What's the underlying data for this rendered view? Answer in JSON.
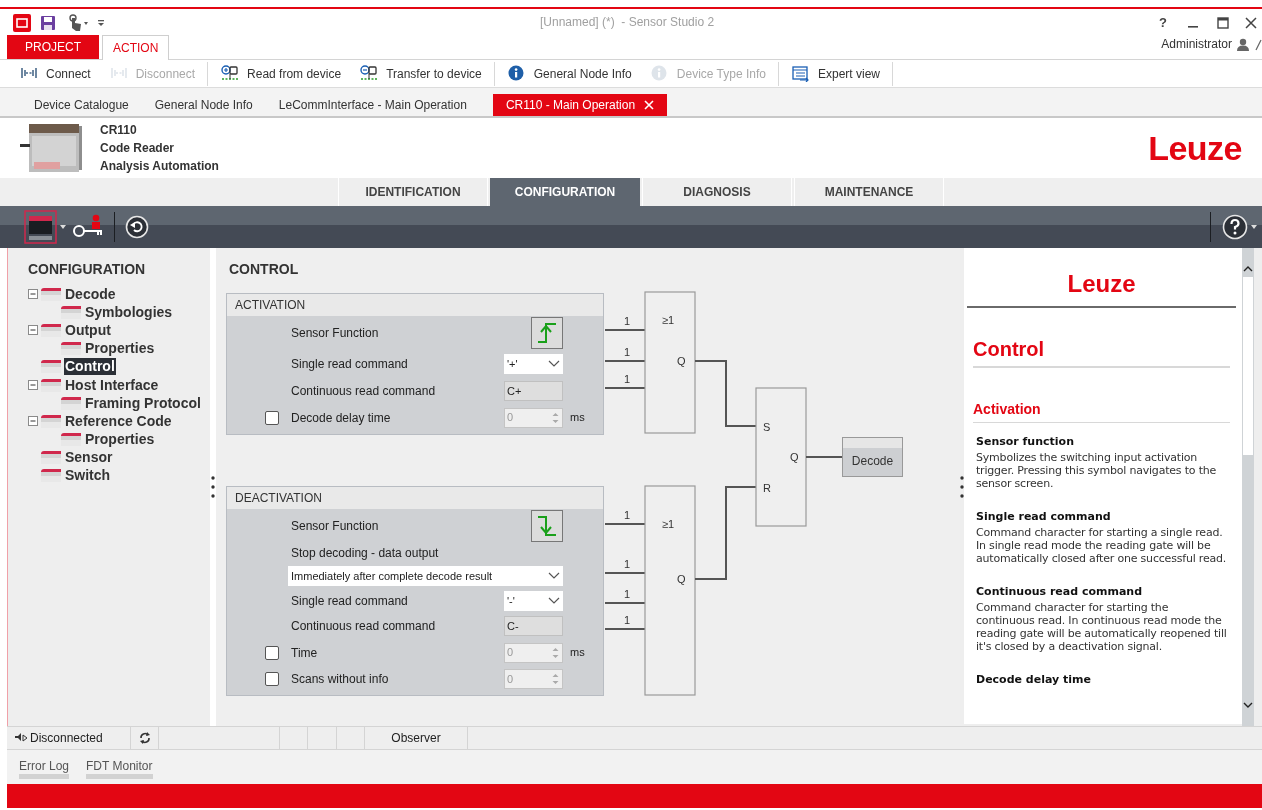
{
  "title_bar": {
    "title": "[Unnamed] (*)  - Sensor Studio 2",
    "help": "?"
  },
  "ribbon_tabs": [
    {
      "label": "PROJECT",
      "kind": "menu",
      "selected": false
    },
    {
      "label": "ACTION",
      "kind": "tab",
      "selected": true
    }
  ],
  "user": "Administrator",
  "toolbar_groups": [
    {
      "items": [
        {
          "label": "Connect",
          "kind": "connect",
          "disabled": false
        },
        {
          "label": "Disconnect",
          "kind": "connect",
          "disabled": true
        }
      ]
    },
    {
      "items": [
        {
          "label": "Read from device",
          "kind": "read",
          "disabled": false
        },
        {
          "label": "Transfer to device",
          "kind": "transfer",
          "disabled": false
        }
      ]
    },
    {
      "items": [
        {
          "label": "General Node Info",
          "kind": "info",
          "disabled": false
        },
        {
          "label": "Device Type Info",
          "kind": "info",
          "disabled": true
        }
      ]
    },
    {
      "items": [
        {
          "label": "Expert view",
          "kind": "expert",
          "disabled": false
        }
      ]
    }
  ],
  "doc_tabs": [
    {
      "label": "Device Catalogue",
      "selected": false
    },
    {
      "label": "General Node Info",
      "selected": false
    },
    {
      "label": "LeCommInterface - Main Operation",
      "selected": false
    },
    {
      "label": "CR110 - Main Operation",
      "selected": true
    }
  ],
  "device": {
    "lines": [
      "CR110",
      "Code Reader",
      "Analysis Automation"
    ],
    "logo": "Leuze"
  },
  "nav_tabs": [
    {
      "label": "IDENTIFICATION",
      "selected": false
    },
    {
      "label": "CONFIGURATION",
      "selected": true
    },
    {
      "label": "DIAGNOSIS",
      "selected": false
    },
    {
      "label": "MAINTENANCE",
      "selected": false
    }
  ],
  "tree": {
    "title": "CONFIGURATION",
    "items": [
      {
        "label": "Decode",
        "selected": false,
        "expanded": true,
        "children": [
          {
            "label": "Symbologies",
            "selected": false
          }
        ]
      },
      {
        "label": "Output",
        "selected": false,
        "expanded": true,
        "children": [
          {
            "label": "Properties",
            "selected": false
          }
        ]
      },
      {
        "label": "Control",
        "selected": true
      },
      {
        "label": "Host Interface",
        "selected": false,
        "expanded": true,
        "children": [
          {
            "label": "Framing Protocol",
            "selected": false
          }
        ]
      },
      {
        "label": "Reference Code",
        "selected": false,
        "expanded": true,
        "children": [
          {
            "label": "Properties",
            "selected": false
          }
        ]
      },
      {
        "label": "Sensor",
        "selected": false
      },
      {
        "label": "Switch",
        "selected": false
      }
    ]
  },
  "control": {
    "title": "CONTROL",
    "panels": [
      {
        "title": "ACTIVATION",
        "rows": [
          {
            "kind": "sensor",
            "label": "Sensor Function",
            "rising": true
          },
          {
            "kind": "dropdown",
            "label": "Single read command",
            "value": "'+'"
          },
          {
            "kind": "text",
            "label": "Continuous read command",
            "value": "C+"
          },
          {
            "kind": "spin",
            "label": "Decode delay time",
            "checked": false,
            "disabled": true,
            "value": "0",
            "unit": "ms"
          }
        ]
      },
      {
        "title": "DEACTIVATION",
        "rows": [
          {
            "kind": "sensor",
            "label": "Sensor Function",
            "rising": false
          },
          {
            "kind": "label",
            "label": "Stop decoding - data output"
          },
          {
            "kind": "wide_dropdown",
            "value": "Immediately after complete decode result"
          },
          {
            "kind": "dropdown",
            "label": "Single read command",
            "value": "'-'"
          },
          {
            "kind": "text",
            "label": "Continuous read command",
            "value": "C-"
          },
          {
            "kind": "spin",
            "label": "Time",
            "checked": false,
            "disabled": true,
            "value": "0",
            "unit": "ms"
          },
          {
            "kind": "spin",
            "label": "Scans without info",
            "checked": false,
            "disabled": true,
            "value": "0"
          }
        ]
      }
    ]
  },
  "diagram": {
    "gates": [
      {
        "symbol": "≥1",
        "output": "Q",
        "inputs": [
          "1",
          "1",
          "1"
        ]
      },
      {
        "symbol": "≥1",
        "output": "Q",
        "inputs": [
          "1",
          "1",
          "1",
          "1"
        ]
      }
    ],
    "flipflop": {
      "set": "S",
      "reset": "R",
      "output": "Q"
    },
    "target": "Decode"
  },
  "help": {
    "logo": "Leuze",
    "title": "Control",
    "section": "Activation",
    "entries": [
      {
        "heading": "Sensor function",
        "text": "Symbolizes the switching input activation trigger. Pressing this symbol navigates to the sensor screen."
      },
      {
        "heading": "Single read command",
        "text": "Command character for starting a single read. In single read mode the reading gate will be automatically closed after one successful read."
      },
      {
        "heading": "Continuous read command",
        "text": "Command character for starting the continuous read. In continuous read mode the reading gate will be automatically reopened till it's closed by a deactivation signal."
      },
      {
        "heading": "Decode delay time"
      }
    ]
  },
  "status_bar": {
    "connection": "Disconnected",
    "mode": "Observer"
  },
  "bottom_tabs": [
    {
      "label": "Error Log"
    },
    {
      "label": "FDT Monitor"
    }
  ]
}
